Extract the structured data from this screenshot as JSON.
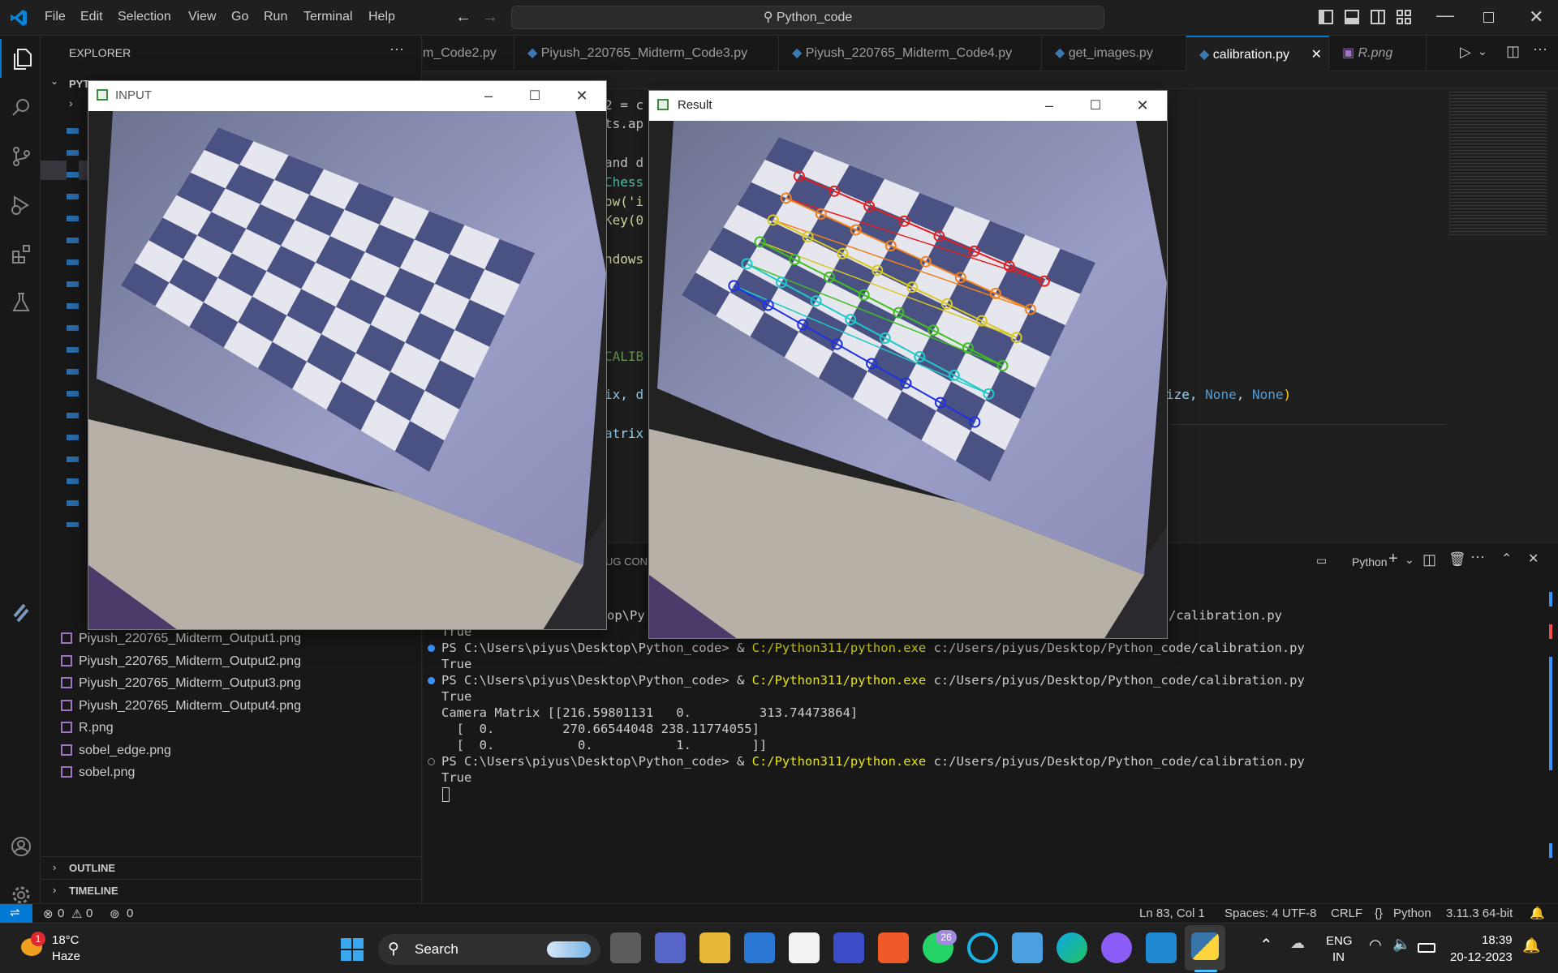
{
  "menu": [
    "File",
    "Edit",
    "Selection",
    "View",
    "Go",
    "Run",
    "Terminal",
    "Help"
  ],
  "search": "Python_code",
  "explorer": {
    "title": "EXPLORER",
    "folder": "PYTHON_CODE",
    "files": [
      "Piyush_220765_Midterm_Output1.png",
      "Piyush_220765_Midterm_Output2.png",
      "Piyush_220765_Midterm_Output3.png",
      "Piyush_220765_Midterm_Output4.png",
      "R.png",
      "sobel_edge.png",
      "sobel.png"
    ],
    "outline": "OUTLINE",
    "timeline": "TIMELINE"
  },
  "tabs": [
    {
      "label": "m_Code2.py"
    },
    {
      "label": "Piyush_220765_Midterm_Code3.py"
    },
    {
      "label": "Piyush_220765_Midterm_Code4.py"
    },
    {
      "label": "get_images.py"
    },
    {
      "label": "calibration.py"
    },
    {
      "label": "R.png"
    }
  ],
  "code": {
    "l1": "2 = c",
    "l2": "ts.ap",
    "l3": "and d",
    "l4": "Chess",
    "l5": "ow('i",
    "l6": "Key(0",
    "l7": "ndows",
    "l8": "CALIB",
    "l9a": "ix, d",
    "l9b": "ize, ",
    "l9c": "None",
    "l9d": ", ",
    "l9e": "None",
    "l9f": ")",
    "l10": "atrix",
    "dbg": "UG CON"
  },
  "panel": {
    "shell": "Python"
  },
  "terminal": {
    "lines": [
      {
        "prompt": "PS C:\\Users\\piyus\\Desktop\\Python_code> & ",
        "exe": "C:/Python311/python.exe",
        "args": " c:/Users/piyus/Desktop/Python_code/calibration.py"
      },
      {
        "prompt": "PS C:\\Users\\piyus\\Desktop\\Python_code> & ",
        "exe": "C:/Python311/python.exe",
        "args": " c:/Users/piyus/Desktop/Python_code/calibration.py"
      },
      {
        "prompt": "PS C:\\Users\\piyus\\Desktop\\Python_code> & ",
        "exe": "C:/Python311/python.exe",
        "args": " c:/Users/piyus/Desktop/Python_code/calibration.py"
      }
    ],
    "partial_prompt": "op\\Py",
    "partial_tail": "/calibration.py",
    "true": "True",
    "matrix": [
      "Camera Matrix [[216.59801131   0.         313.74473864]",
      "  [  0.         270.66544048 238.11774055]",
      "  [  0.           0.           1.        ]]"
    ]
  },
  "windows": {
    "input": "INPUT",
    "result": "Result"
  },
  "status": {
    "errors": "0",
    "warnings": "0",
    "ports": "0",
    "pos": "Ln 83, Col 1",
    "spaces": "Spaces: 4",
    "enc": "UTF-8",
    "eol": "CRLF",
    "lang": "Python",
    "ver": "3.11.3 64-bit"
  },
  "taskbar": {
    "temp": "18°C",
    "weather": "Haze",
    "badge": "1",
    "search": "Search",
    "wa_badge": "26",
    "lang1": "ENG",
    "lang2": "IN",
    "time": "18:39",
    "date": "20-12-2023"
  },
  "colors": {
    "accent": "#0078d4",
    "yellow": "#dcdcaa",
    "blue": "#569cd6"
  }
}
